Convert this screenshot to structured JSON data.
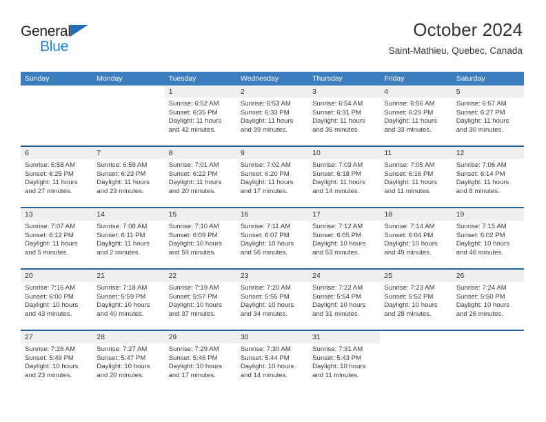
{
  "brand": {
    "word1": "General",
    "word2": "Blue",
    "flag_icon": "triangle-flag-icon",
    "accent_color": "#1f7fd0"
  },
  "header": {
    "title": "October 2024",
    "subtitle": "Saint-Mathieu, Quebec, Canada"
  },
  "calendar": {
    "header_color": "#3b7dbf",
    "row_rule_color": "#2a6099",
    "daynum_bg": "#efefef",
    "weekdays": [
      "Sunday",
      "Monday",
      "Tuesday",
      "Wednesday",
      "Thursday",
      "Friday",
      "Saturday"
    ],
    "weeks": [
      [
        {
          "day": "",
          "info": "",
          "blank": true
        },
        {
          "day": "",
          "info": "",
          "blank": true
        },
        {
          "day": "1",
          "info": "Sunrise: 6:52 AM\nSunset: 6:35 PM\nDaylight: 11 hours\nand 42 minutes."
        },
        {
          "day": "2",
          "info": "Sunrise: 6:53 AM\nSunset: 6:33 PM\nDaylight: 11 hours\nand 39 minutes."
        },
        {
          "day": "3",
          "info": "Sunrise: 6:54 AM\nSunset: 6:31 PM\nDaylight: 11 hours\nand 36 minutes."
        },
        {
          "day": "4",
          "info": "Sunrise: 6:56 AM\nSunset: 6:29 PM\nDaylight: 11 hours\nand 33 minutes."
        },
        {
          "day": "5",
          "info": "Sunrise: 6:57 AM\nSunset: 6:27 PM\nDaylight: 11 hours\nand 30 minutes."
        }
      ],
      [
        {
          "day": "6",
          "info": "Sunrise: 6:58 AM\nSunset: 6:25 PM\nDaylight: 11 hours\nand 27 minutes."
        },
        {
          "day": "7",
          "info": "Sunrise: 6:59 AM\nSunset: 6:23 PM\nDaylight: 11 hours\nand 23 minutes."
        },
        {
          "day": "8",
          "info": "Sunrise: 7:01 AM\nSunset: 6:22 PM\nDaylight: 11 hours\nand 20 minutes."
        },
        {
          "day": "9",
          "info": "Sunrise: 7:02 AM\nSunset: 6:20 PM\nDaylight: 11 hours\nand 17 minutes."
        },
        {
          "day": "10",
          "info": "Sunrise: 7:03 AM\nSunset: 6:18 PM\nDaylight: 11 hours\nand 14 minutes."
        },
        {
          "day": "11",
          "info": "Sunrise: 7:05 AM\nSunset: 6:16 PM\nDaylight: 11 hours\nand 11 minutes."
        },
        {
          "day": "12",
          "info": "Sunrise: 7:06 AM\nSunset: 6:14 PM\nDaylight: 11 hours\nand 8 minutes."
        }
      ],
      [
        {
          "day": "13",
          "info": "Sunrise: 7:07 AM\nSunset: 6:12 PM\nDaylight: 11 hours\nand 5 minutes."
        },
        {
          "day": "14",
          "info": "Sunrise: 7:08 AM\nSunset: 6:11 PM\nDaylight: 11 hours\nand 2 minutes."
        },
        {
          "day": "15",
          "info": "Sunrise: 7:10 AM\nSunset: 6:09 PM\nDaylight: 10 hours\nand 59 minutes."
        },
        {
          "day": "16",
          "info": "Sunrise: 7:11 AM\nSunset: 6:07 PM\nDaylight: 10 hours\nand 56 minutes."
        },
        {
          "day": "17",
          "info": "Sunrise: 7:12 AM\nSunset: 6:05 PM\nDaylight: 10 hours\nand 53 minutes."
        },
        {
          "day": "18",
          "info": "Sunrise: 7:14 AM\nSunset: 6:04 PM\nDaylight: 10 hours\nand 49 minutes."
        },
        {
          "day": "19",
          "info": "Sunrise: 7:15 AM\nSunset: 6:02 PM\nDaylight: 10 hours\nand 46 minutes."
        }
      ],
      [
        {
          "day": "20",
          "info": "Sunrise: 7:16 AM\nSunset: 6:00 PM\nDaylight: 10 hours\nand 43 minutes."
        },
        {
          "day": "21",
          "info": "Sunrise: 7:18 AM\nSunset: 5:59 PM\nDaylight: 10 hours\nand 40 minutes."
        },
        {
          "day": "22",
          "info": "Sunrise: 7:19 AM\nSunset: 5:57 PM\nDaylight: 10 hours\nand 37 minutes."
        },
        {
          "day": "23",
          "info": "Sunrise: 7:20 AM\nSunset: 5:55 PM\nDaylight: 10 hours\nand 34 minutes."
        },
        {
          "day": "24",
          "info": "Sunrise: 7:22 AM\nSunset: 5:54 PM\nDaylight: 10 hours\nand 31 minutes."
        },
        {
          "day": "25",
          "info": "Sunrise: 7:23 AM\nSunset: 5:52 PM\nDaylight: 10 hours\nand 28 minutes."
        },
        {
          "day": "26",
          "info": "Sunrise: 7:24 AM\nSunset: 5:50 PM\nDaylight: 10 hours\nand 26 minutes."
        }
      ],
      [
        {
          "day": "27",
          "info": "Sunrise: 7:26 AM\nSunset: 5:49 PM\nDaylight: 10 hours\nand 23 minutes."
        },
        {
          "day": "28",
          "info": "Sunrise: 7:27 AM\nSunset: 5:47 PM\nDaylight: 10 hours\nand 20 minutes."
        },
        {
          "day": "29",
          "info": "Sunrise: 7:29 AM\nSunset: 5:46 PM\nDaylight: 10 hours\nand 17 minutes."
        },
        {
          "day": "30",
          "info": "Sunrise: 7:30 AM\nSunset: 5:44 PM\nDaylight: 10 hours\nand 14 minutes."
        },
        {
          "day": "31",
          "info": "Sunrise: 7:31 AM\nSunset: 5:43 PM\nDaylight: 10 hours\nand 11 minutes."
        },
        {
          "day": "",
          "info": "",
          "blank": true
        },
        {
          "day": "",
          "info": "",
          "blank": true
        }
      ]
    ]
  }
}
